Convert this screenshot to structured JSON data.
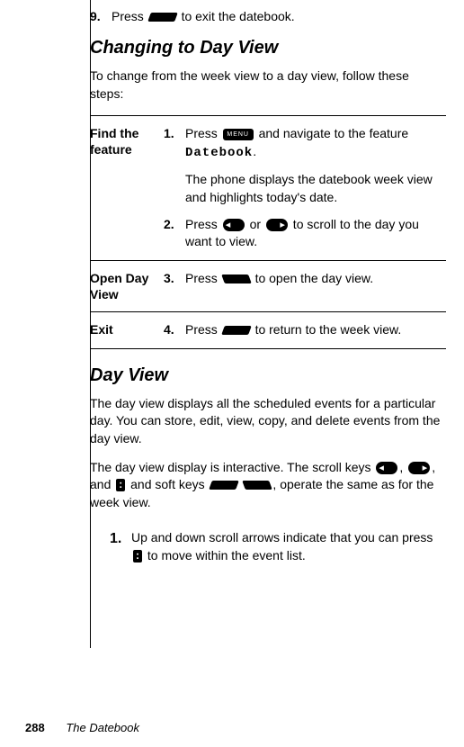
{
  "page": {
    "number": "288",
    "section": "The Datebook"
  },
  "top_step": {
    "num": "9.",
    "text_before": "Press ",
    "text_after": " to exit the datebook."
  },
  "section1": {
    "title": "Changing to Day View",
    "intro": "To change from the week view to a day view, follow these steps:"
  },
  "table": {
    "row1": {
      "label": "Find the feature",
      "step1": {
        "num": "1.",
        "before": "Press ",
        "mid": " and navigate to the feature ",
        "feature": "Datebook",
        "after": ".",
        "extra": "The phone displays the datebook week view and highlights today's date."
      },
      "step2": {
        "num": "2.",
        "before": "Press ",
        "mid": " or ",
        "after": " to scroll to the day you want to view."
      }
    },
    "row2": {
      "label": "Open Day View",
      "step3": {
        "num": "3.",
        "before": "Press ",
        "after": " to open the day view."
      }
    },
    "row3": {
      "label": "Exit",
      "step4": {
        "num": "4.",
        "before": "Press ",
        "after": " to return to the week view."
      }
    }
  },
  "section2": {
    "title": "Day View",
    "para1": "The day view displays all the scheduled events for a particular day. You can store, edit, view, copy, and delete events from the day view.",
    "para2_a": "The day view display is interactive. The scroll keys ",
    "para2_b": ", ",
    "para2_c": ", and ",
    "para2_d": " and soft keys ",
    "para2_e": " ",
    "para2_f": ", operate the same as for the week view."
  },
  "bottom_step": {
    "num": "1.",
    "before": "Up and down scroll arrows indicate that you can press ",
    "after": " to move within the event list."
  },
  "menu_label": "MENU"
}
